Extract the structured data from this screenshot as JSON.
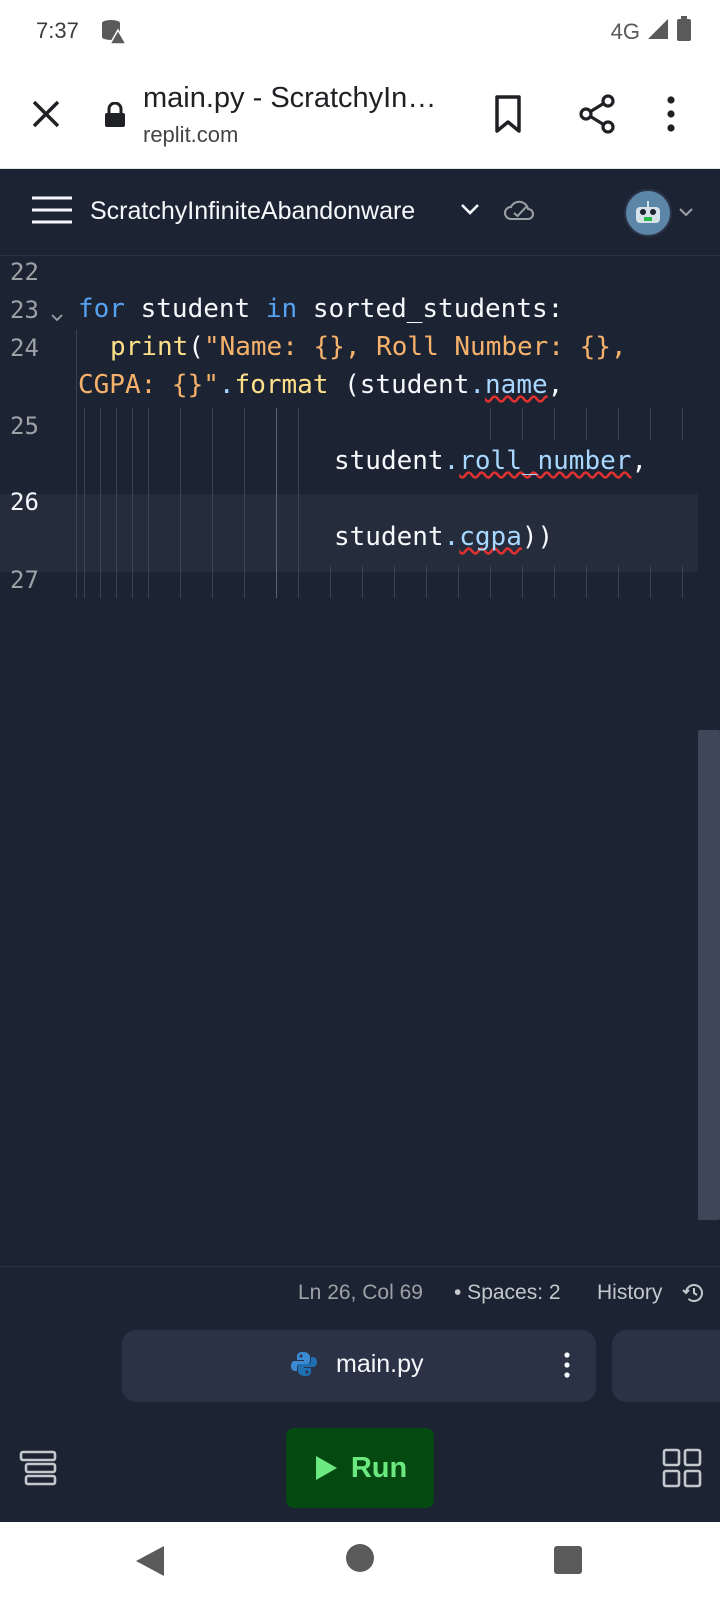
{
  "status_bar": {
    "time": "7:37",
    "network": "4G"
  },
  "browser": {
    "title": "main.py - ScratchyInfiniteAbandonware",
    "url": "replit.com"
  },
  "replit": {
    "repl_name": "ScratchyInfiniteAbandonware"
  },
  "editor": {
    "gutter": [
      "22",
      "23",
      "24",
      "25",
      "26",
      "27"
    ],
    "code": {
      "kw_for": "for",
      "var_student": " student ",
      "kw_in": "in",
      "sorted": " sorted_students:",
      "print": "print",
      "paren_open": "(",
      "str_part1": "\"Name: {}, Roll Number: {},",
      "str_part2": "CGPA: {}\"",
      "format": "format",
      "format_rest": " (student",
      "attr_name": "name",
      "comma": ",",
      "student2": "student",
      "attr_roll": "roll_number",
      "comma2": ",",
      "student3": "student",
      "attr_cgpa": "cgpa",
      "close": "))"
    }
  },
  "statusline": {
    "ln_col": "Ln 26, Col 69",
    "spaces": "• Spaces: 2",
    "history": "History"
  },
  "tab": {
    "file_name": "main.py"
  },
  "actions": {
    "run_label": "Run"
  },
  "colors": {
    "accent_run_bg": "#044a10",
    "accent_run_text": "#6ce880",
    "editor_bg": "#1c2333"
  }
}
